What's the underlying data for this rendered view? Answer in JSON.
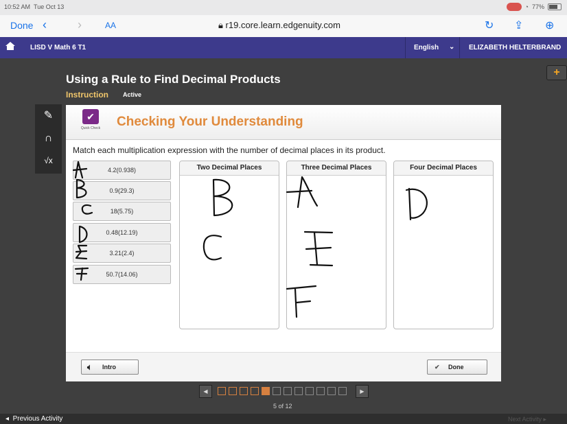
{
  "status_bar": {
    "time": "10:52 AM",
    "date": "Tue Oct 13",
    "battery": "77%"
  },
  "browser": {
    "done_label": "Done",
    "text_size": "AA",
    "url": "r19.core.learn.edgenuity.com"
  },
  "nav": {
    "course": "LISD V Math 6 T1",
    "language": "English",
    "user": "ELIZABETH HELTERBRAND"
  },
  "lesson": {
    "title": "Using a Rule to Find Decimal Products",
    "tab_instruction": "Instruction",
    "tab_active": "Active"
  },
  "activity": {
    "badge": "Quick Check",
    "title": "Checking Your Understanding",
    "instruction": "Match each multiplication expression with the number of decimal places in its product.",
    "expressions": [
      "4.2(0.938)",
      "0.9(29.3)",
      "18(5.75)",
      "0.48(12.19)",
      "3.21(2.4)",
      "50.7(14.06)"
    ],
    "columns": [
      "Two Decimal Places",
      "Three Decimal Places",
      "Four Decimal Places"
    ],
    "intro_label": "Intro",
    "done_label": "Done"
  },
  "pager": {
    "total": 12,
    "current": 5,
    "label": "5 of 12"
  },
  "footer": {
    "prev": "Previous Activity",
    "next": "Next Activity"
  },
  "colors": {
    "nav": "#3d3a8c",
    "accent": "#e08a3c",
    "tab": "#f0c66b",
    "background": "#3f3f3f"
  },
  "handwriting_letters": [
    "A",
    "B",
    "C",
    "D",
    "E",
    "F",
    "B",
    "C",
    "A",
    "E",
    "F",
    "D"
  ]
}
